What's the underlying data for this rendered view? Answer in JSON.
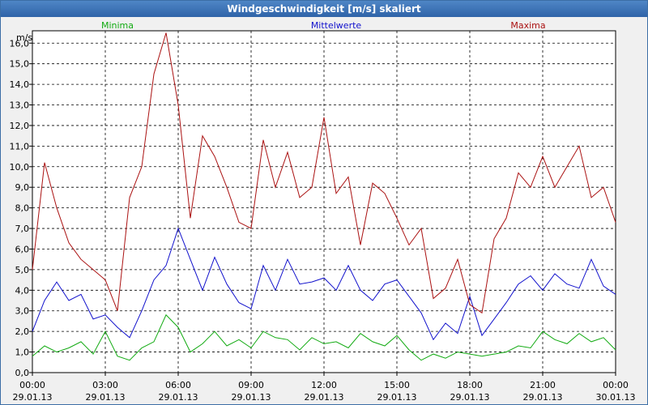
{
  "window": {
    "title": "Windgeschwindigkeit [m/s] skaliert"
  },
  "colors": {
    "minima": "#11aa11",
    "mittel": "#1111cc",
    "maxima": "#aa1111"
  },
  "chart_data": {
    "type": "line",
    "title": "Windgeschwindigkeit [m/s] skaliert",
    "ylabel": "m/s",
    "ylim": [
      0,
      16.6
    ],
    "xlim": [
      0,
      24
    ],
    "x_unit": "hours since 29.01.13 00:00",
    "grid": true,
    "yticks": [
      "0,0",
      "1,0",
      "2,0",
      "3,0",
      "4,0",
      "5,0",
      "6,0",
      "7,0",
      "8,0",
      "9,0",
      "10,0",
      "11,0",
      "12,0",
      "13,0",
      "14,0",
      "15,0",
      "16,0"
    ],
    "xticks": [
      {
        "time": "00:00",
        "date": "29.01.13"
      },
      {
        "time": "03:00",
        "date": "29.01.13"
      },
      {
        "time": "06:00",
        "date": "29.01.13"
      },
      {
        "time": "09:00",
        "date": "29.01.13"
      },
      {
        "time": "12:00",
        "date": "29.01.13"
      },
      {
        "time": "15:00",
        "date": "29.01.13"
      },
      {
        "time": "18:00",
        "date": "29.01.13"
      },
      {
        "time": "21:00",
        "date": "29.01.13"
      },
      {
        "time": "00:00",
        "date": "30.01.13"
      }
    ],
    "legend": [
      "Minima",
      "Mittelwerte",
      "Maxima"
    ],
    "series": [
      {
        "name": "Minima",
        "x": [
          0,
          0.5,
          1,
          1.5,
          2,
          2.5,
          3,
          3.5,
          4,
          4.5,
          5,
          5.5,
          6,
          6.5,
          7,
          7.5,
          8,
          8.5,
          9,
          9.5,
          10,
          10.5,
          11,
          11.5,
          12,
          12.5,
          13,
          13.5,
          14,
          14.5,
          15,
          15.5,
          16,
          16.5,
          17,
          17.5,
          18,
          18.5,
          19,
          19.5,
          20,
          20.5,
          21,
          21.5,
          22,
          22.5,
          23,
          23.5,
          24
        ],
        "values": [
          0.8,
          1.3,
          1.0,
          1.2,
          1.5,
          0.9,
          2.0,
          0.8,
          0.6,
          1.2,
          1.5,
          2.8,
          2.2,
          1.0,
          1.4,
          2.0,
          1.3,
          1.6,
          1.2,
          2.0,
          1.7,
          1.6,
          1.1,
          1.7,
          1.4,
          1.5,
          1.2,
          1.9,
          1.5,
          1.3,
          1.8,
          1.1,
          0.6,
          0.9,
          0.7,
          1.0,
          0.9,
          0.8,
          0.9,
          1.0,
          1.3,
          1.2,
          2.0,
          1.6,
          1.4,
          1.9,
          1.5,
          1.7,
          1.1
        ]
      },
      {
        "name": "Mittelwerte",
        "x": [
          0,
          0.5,
          1,
          1.5,
          2,
          2.5,
          3,
          3.5,
          4,
          4.5,
          5,
          5.5,
          6,
          6.5,
          7,
          7.5,
          8,
          8.5,
          9,
          9.5,
          10,
          10.5,
          11,
          11.5,
          12,
          12.5,
          13,
          13.5,
          14,
          14.5,
          15,
          15.5,
          16,
          16.5,
          17,
          17.5,
          18,
          18.5,
          19,
          19.5,
          20,
          20.5,
          21,
          21.5,
          22,
          22.5,
          23,
          23.5,
          24
        ],
        "values": [
          2.0,
          3.5,
          4.4,
          3.5,
          3.8,
          2.6,
          2.8,
          2.2,
          1.7,
          3.0,
          4.5,
          5.2,
          7.0,
          5.5,
          4.0,
          5.6,
          4.3,
          3.4,
          3.1,
          5.2,
          4.0,
          5.5,
          4.3,
          4.4,
          4.6,
          4.0,
          5.2,
          4.0,
          3.5,
          4.3,
          4.5,
          3.7,
          2.9,
          1.6,
          2.4,
          1.9,
          3.7,
          1.8,
          2.6,
          3.4,
          4.3,
          4.7,
          4.0,
          4.8,
          4.3,
          4.1,
          5.5,
          4.2,
          3.8
        ]
      },
      {
        "name": "Maxima",
        "x": [
          0,
          0.5,
          1,
          1.5,
          2,
          2.5,
          3,
          3.5,
          4,
          4.5,
          5,
          5.5,
          6,
          6.5,
          7,
          7.5,
          8,
          8.5,
          9,
          9.5,
          10,
          10.5,
          11,
          11.5,
          12,
          12.5,
          13,
          13.5,
          14,
          14.5,
          15,
          15.5,
          16,
          16.5,
          17,
          17.5,
          18,
          18.5,
          19,
          19.5,
          20,
          20.5,
          21,
          21.5,
          22,
          22.5,
          23,
          23.5,
          24
        ],
        "values": [
          5.0,
          10.2,
          8.0,
          6.3,
          5.5,
          5.0,
          4.5,
          3.0,
          8.5,
          10.0,
          14.5,
          16.5,
          13.0,
          7.5,
          11.5,
          10.5,
          9.0,
          7.3,
          7.0,
          11.3,
          9.0,
          10.7,
          8.5,
          9.0,
          12.4,
          8.7,
          9.5,
          6.2,
          9.2,
          8.7,
          7.5,
          6.2,
          7.0,
          3.6,
          4.1,
          5.5,
          3.3,
          2.9,
          6.5,
          7.5,
          9.7,
          9.0,
          10.5,
          9.0,
          10.0,
          11.0,
          8.5,
          9.0,
          7.3
        ]
      }
    ]
  }
}
